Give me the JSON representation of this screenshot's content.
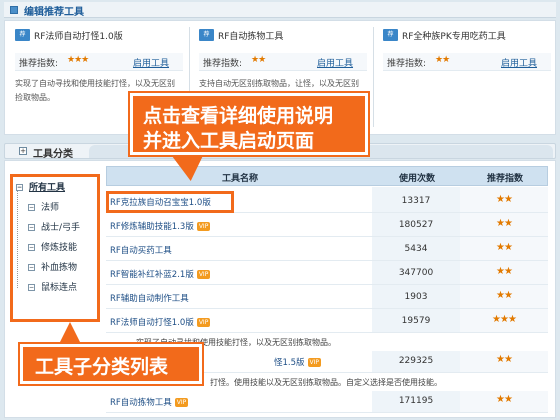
{
  "header": {
    "title": "编辑推荐工具"
  },
  "recommended": [
    {
      "badge": "荐",
      "name": "RF法师自动打怪1.0版",
      "label": "推荐指数:",
      "stars": "★★★",
      "link": "启用工具",
      "desc": "实现了自动寻找和使用技能打怪，以及无区别捡取物品。"
    },
    {
      "badge": "荐",
      "name": "RF自动拣物工具",
      "label": "推荐指数:",
      "stars": "★★",
      "link": "启用工具",
      "desc": "支持自动无区别拣取物品，让怪，以及无区别拾取物品。"
    },
    {
      "badge": "荐",
      "name": "RF全种族PK专用吃药工具",
      "label": "推荐指数:",
      "stars": "★★",
      "link": "启用工具",
      "desc": ""
    }
  ],
  "section": {
    "title": "工具分类"
  },
  "tree": {
    "root": "所有工具",
    "items": [
      "法师",
      "战士/弓手",
      "修炼技能",
      "补血拣物",
      "鼠标连点"
    ]
  },
  "table": {
    "headers": {
      "name": "工具名称",
      "uses": "使用次数",
      "rating": "推荐指数"
    },
    "rows": [
      {
        "name": "RF克拉族自动召宝宝1.0版",
        "vip": "",
        "uses": "13317",
        "stars": "★★"
      },
      {
        "name": "RF修炼辅助技能1.3版",
        "vip": "VIP",
        "uses": "180527",
        "stars": "★★"
      },
      {
        "name": "RF自动买药工具",
        "vip": "",
        "uses": "5434",
        "stars": "★★"
      },
      {
        "name": "RF智能补红补蓝2.1版",
        "vip": "VIP",
        "uses": "347700",
        "stars": "★★"
      },
      {
        "name": "RF辅助自动制作工具",
        "vip": "",
        "uses": "1903",
        "stars": "★★"
      },
      {
        "name": "RF法师自动打怪1.0版",
        "vip": "VIP",
        "uses": "19579",
        "stars": "★★★"
      },
      {
        "name": "怪1.5版",
        "vip": "VIP",
        "uses": "229325",
        "stars": "★★"
      },
      {
        "name": "RF自动拣物工具",
        "vip": "VIP",
        "uses": "171195",
        "stars": "★★"
      }
    ],
    "detail1": "实现了自动寻找和使用技能打怪，以及无区别拣取物品。",
    "detail2": "打怪。使用技能以及无区别拣取物品。自定义选择是否使用技能。"
  },
  "annotations": {
    "callout1_line1": "点击查看详细使用说明",
    "callout1_line2": "并进入工具启动页面",
    "callout2": "工具子分类列表"
  },
  "colors": {
    "accent": "#f26a1b",
    "link": "#1f5e9a",
    "star": "#e27a00",
    "header_bg": "#cfe1f0"
  }
}
